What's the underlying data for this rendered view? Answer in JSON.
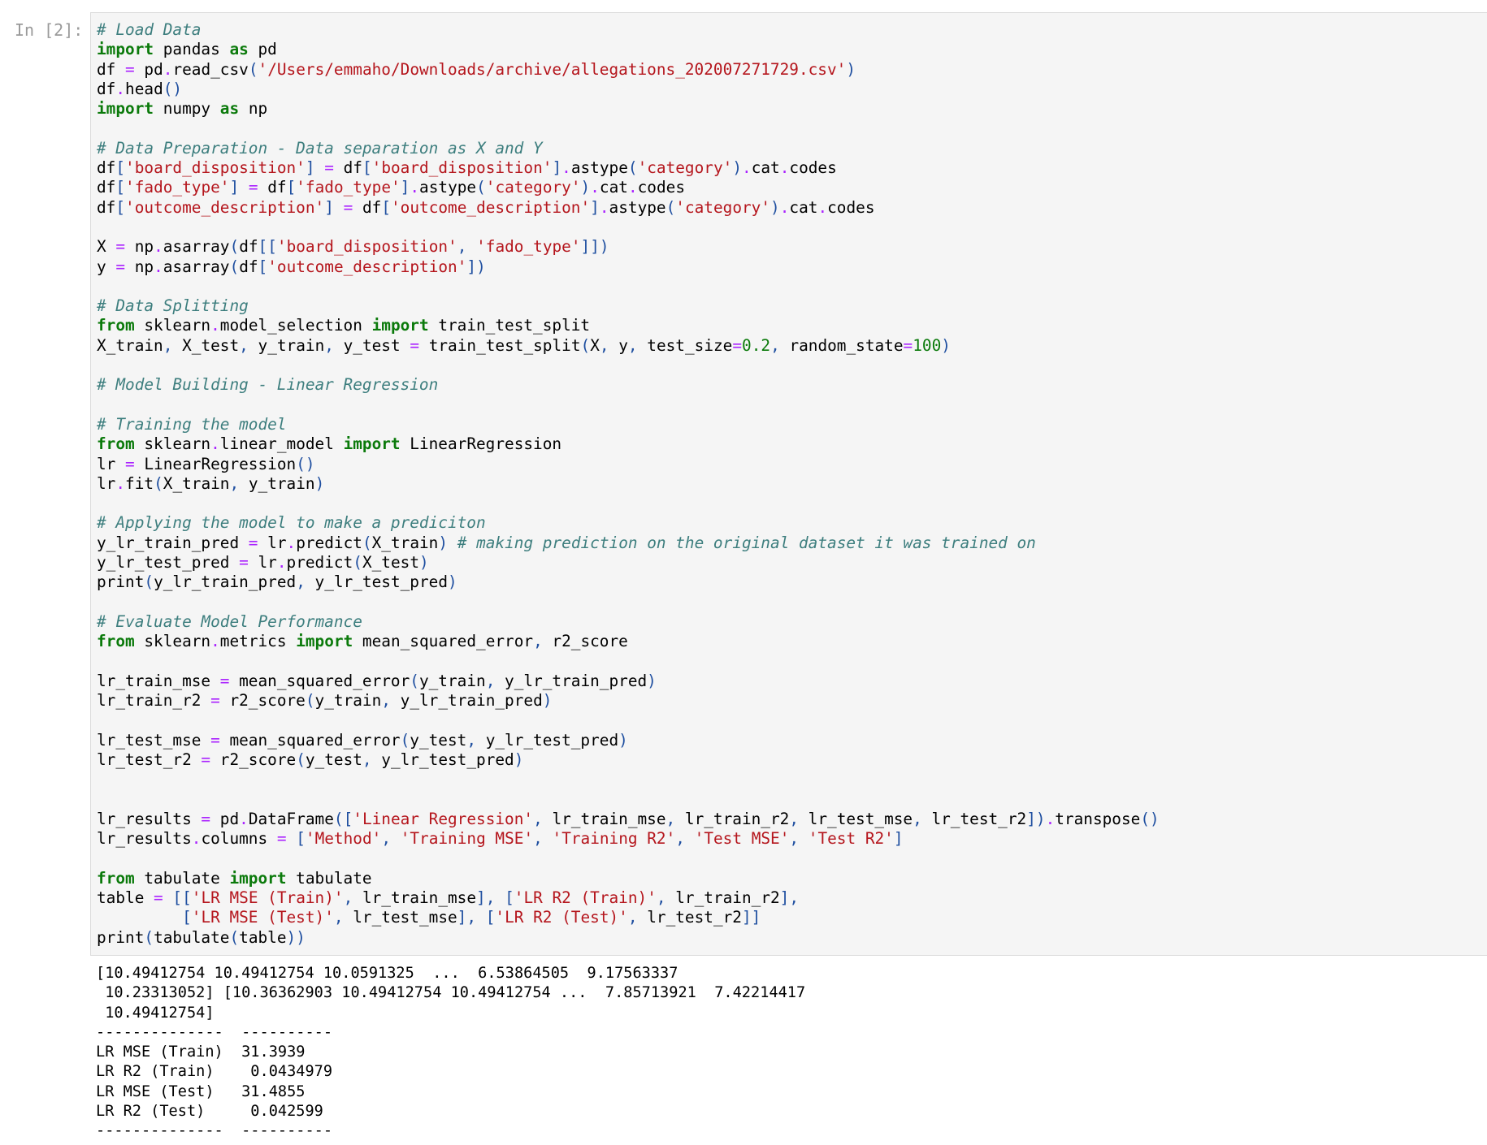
{
  "cell": {
    "prompt": "In [2]:",
    "code_lines": [
      [
        [
          "cm",
          "# Load Data"
        ]
      ],
      [
        [
          "kw",
          "import"
        ],
        [
          "",
          " pandas "
        ],
        [
          "kw",
          "as"
        ],
        [
          "",
          " pd"
        ]
      ],
      [
        [
          "",
          "df "
        ],
        [
          "op",
          "="
        ],
        [
          "",
          " pd"
        ],
        [
          "op",
          "."
        ],
        [
          "",
          "read_csv"
        ],
        [
          "pn",
          "("
        ],
        [
          "st",
          "'/Users/emmaho/Downloads/archive/allegations_202007271729.csv'"
        ],
        [
          "pn",
          ")"
        ]
      ],
      [
        [
          "",
          "df"
        ],
        [
          "op",
          "."
        ],
        [
          "",
          "head"
        ],
        [
          "pn",
          "()"
        ]
      ],
      [
        [
          "kw",
          "import"
        ],
        [
          "",
          " numpy "
        ],
        [
          "kw",
          "as"
        ],
        [
          "",
          " np"
        ]
      ],
      [],
      [
        [
          "cm",
          "# Data Preparation - Data separation as X and Y"
        ]
      ],
      [
        [
          "",
          "df"
        ],
        [
          "pn",
          "["
        ],
        [
          "st",
          "'board_disposition'"
        ],
        [
          "pn",
          "]"
        ],
        [
          "",
          " "
        ],
        [
          "op",
          "="
        ],
        [
          "",
          " df"
        ],
        [
          "pn",
          "["
        ],
        [
          "st",
          "'board_disposition'"
        ],
        [
          "pn",
          "]"
        ],
        [
          "op",
          "."
        ],
        [
          "",
          "astype"
        ],
        [
          "pn",
          "("
        ],
        [
          "st",
          "'category'"
        ],
        [
          "pn",
          ")"
        ],
        [
          "op",
          "."
        ],
        [
          "",
          "cat"
        ],
        [
          "op",
          "."
        ],
        [
          "",
          "codes"
        ]
      ],
      [
        [
          "",
          "df"
        ],
        [
          "pn",
          "["
        ],
        [
          "st",
          "'fado_type'"
        ],
        [
          "pn",
          "]"
        ],
        [
          "",
          " "
        ],
        [
          "op",
          "="
        ],
        [
          "",
          " df"
        ],
        [
          "pn",
          "["
        ],
        [
          "st",
          "'fado_type'"
        ],
        [
          "pn",
          "]"
        ],
        [
          "op",
          "."
        ],
        [
          "",
          "astype"
        ],
        [
          "pn",
          "("
        ],
        [
          "st",
          "'category'"
        ],
        [
          "pn",
          ")"
        ],
        [
          "op",
          "."
        ],
        [
          "",
          "cat"
        ],
        [
          "op",
          "."
        ],
        [
          "",
          "codes"
        ]
      ],
      [
        [
          "",
          "df"
        ],
        [
          "pn",
          "["
        ],
        [
          "st",
          "'outcome_description'"
        ],
        [
          "pn",
          "]"
        ],
        [
          "",
          " "
        ],
        [
          "op",
          "="
        ],
        [
          "",
          " df"
        ],
        [
          "pn",
          "["
        ],
        [
          "st",
          "'outcome_description'"
        ],
        [
          "pn",
          "]"
        ],
        [
          "op",
          "."
        ],
        [
          "",
          "astype"
        ],
        [
          "pn",
          "("
        ],
        [
          "st",
          "'category'"
        ],
        [
          "pn",
          ")"
        ],
        [
          "op",
          "."
        ],
        [
          "",
          "cat"
        ],
        [
          "op",
          "."
        ],
        [
          "",
          "codes"
        ]
      ],
      [],
      [
        [
          "",
          "X "
        ],
        [
          "op",
          "="
        ],
        [
          "",
          " np"
        ],
        [
          "op",
          "."
        ],
        [
          "",
          "asarray"
        ],
        [
          "pn",
          "("
        ],
        [
          "",
          "df"
        ],
        [
          "pn",
          "[["
        ],
        [
          "st",
          "'board_disposition'"
        ],
        [
          "pn",
          ","
        ],
        [
          "",
          " "
        ],
        [
          "st",
          "'fado_type'"
        ],
        [
          "pn",
          "]])"
        ]
      ],
      [
        [
          "",
          "y "
        ],
        [
          "op",
          "="
        ],
        [
          "",
          " np"
        ],
        [
          "op",
          "."
        ],
        [
          "",
          "asarray"
        ],
        [
          "pn",
          "("
        ],
        [
          "",
          "df"
        ],
        [
          "pn",
          "["
        ],
        [
          "st",
          "'outcome_description'"
        ],
        [
          "pn",
          "])"
        ]
      ],
      [],
      [
        [
          "cm",
          "# Data Splitting"
        ]
      ],
      [
        [
          "kw",
          "from"
        ],
        [
          "",
          " sklearn"
        ],
        [
          "op",
          "."
        ],
        [
          "",
          "model_selection "
        ],
        [
          "kw",
          "import"
        ],
        [
          "",
          " train_test_split"
        ]
      ],
      [
        [
          "",
          "X_train"
        ],
        [
          "pn",
          ","
        ],
        [
          "",
          " X_test"
        ],
        [
          "pn",
          ","
        ],
        [
          "",
          " y_train"
        ],
        [
          "pn",
          ","
        ],
        [
          "",
          " y_test "
        ],
        [
          "op",
          "="
        ],
        [
          "",
          " train_test_split"
        ],
        [
          "pn",
          "("
        ],
        [
          "",
          "X"
        ],
        [
          "pn",
          ","
        ],
        [
          "",
          " y"
        ],
        [
          "pn",
          ","
        ],
        [
          "",
          " test_size"
        ],
        [
          "op",
          "="
        ],
        [
          "nm",
          "0.2"
        ],
        [
          "pn",
          ","
        ],
        [
          "",
          " random_state"
        ],
        [
          "op",
          "="
        ],
        [
          "nm",
          "100"
        ],
        [
          "pn",
          ")"
        ]
      ],
      [],
      [
        [
          "cm",
          "# Model Building - Linear Regression"
        ]
      ],
      [],
      [
        [
          "cm",
          "# Training the model"
        ]
      ],
      [
        [
          "kw",
          "from"
        ],
        [
          "",
          " sklearn"
        ],
        [
          "op",
          "."
        ],
        [
          "",
          "linear_model "
        ],
        [
          "kw",
          "import"
        ],
        [
          "",
          " LinearRegression"
        ]
      ],
      [
        [
          "",
          "lr "
        ],
        [
          "op",
          "="
        ],
        [
          "",
          " LinearRegression"
        ],
        [
          "pn",
          "()"
        ]
      ],
      [
        [
          "",
          "lr"
        ],
        [
          "op",
          "."
        ],
        [
          "",
          "fit"
        ],
        [
          "pn",
          "("
        ],
        [
          "",
          "X_train"
        ],
        [
          "pn",
          ","
        ],
        [
          "",
          " y_train"
        ],
        [
          "pn",
          ")"
        ]
      ],
      [],
      [
        [
          "cm",
          "# Applying the model to make a prediciton"
        ]
      ],
      [
        [
          "",
          "y_lr_train_pred "
        ],
        [
          "op",
          "="
        ],
        [
          "",
          " lr"
        ],
        [
          "op",
          "."
        ],
        [
          "",
          "predict"
        ],
        [
          "pn",
          "("
        ],
        [
          "",
          "X_train"
        ],
        [
          "pn",
          ")"
        ],
        [
          "",
          " "
        ],
        [
          "cm",
          "# making prediction on the original dataset it was trained on"
        ]
      ],
      [
        [
          "",
          "y_lr_test_pred "
        ],
        [
          "op",
          "="
        ],
        [
          "",
          " lr"
        ],
        [
          "op",
          "."
        ],
        [
          "",
          "predict"
        ],
        [
          "pn",
          "("
        ],
        [
          "",
          "X_test"
        ],
        [
          "pn",
          ")"
        ]
      ],
      [
        [
          "",
          "print"
        ],
        [
          "pn",
          "("
        ],
        [
          "",
          "y_lr_train_pred"
        ],
        [
          "pn",
          ","
        ],
        [
          "",
          " y_lr_test_pred"
        ],
        [
          "pn",
          ")"
        ]
      ],
      [],
      [
        [
          "cm",
          "# Evaluate Model Performance"
        ]
      ],
      [
        [
          "kw",
          "from"
        ],
        [
          "",
          " sklearn"
        ],
        [
          "op",
          "."
        ],
        [
          "",
          "metrics "
        ],
        [
          "kw",
          "import"
        ],
        [
          "",
          " mean_squared_error"
        ],
        [
          "pn",
          ","
        ],
        [
          "",
          " r2_score"
        ]
      ],
      [],
      [
        [
          "",
          "lr_train_mse "
        ],
        [
          "op",
          "="
        ],
        [
          "",
          " mean_squared_error"
        ],
        [
          "pn",
          "("
        ],
        [
          "",
          "y_train"
        ],
        [
          "pn",
          ","
        ],
        [
          "",
          " y_lr_train_pred"
        ],
        [
          "pn",
          ")"
        ]
      ],
      [
        [
          "",
          "lr_train_r2 "
        ],
        [
          "op",
          "="
        ],
        [
          "",
          " r2_score"
        ],
        [
          "pn",
          "("
        ],
        [
          "",
          "y_train"
        ],
        [
          "pn",
          ","
        ],
        [
          "",
          " y_lr_train_pred"
        ],
        [
          "pn",
          ")"
        ]
      ],
      [],
      [
        [
          "",
          "lr_test_mse "
        ],
        [
          "op",
          "="
        ],
        [
          "",
          " mean_squared_error"
        ],
        [
          "pn",
          "("
        ],
        [
          "",
          "y_test"
        ],
        [
          "pn",
          ","
        ],
        [
          "",
          " y_lr_test_pred"
        ],
        [
          "pn",
          ")"
        ]
      ],
      [
        [
          "",
          "lr_test_r2 "
        ],
        [
          "op",
          "="
        ],
        [
          "",
          " r2_score"
        ],
        [
          "pn",
          "("
        ],
        [
          "",
          "y_test"
        ],
        [
          "pn",
          ","
        ],
        [
          "",
          " y_lr_test_pred"
        ],
        [
          "pn",
          ")"
        ]
      ],
      [],
      [],
      [
        [
          "",
          "lr_results "
        ],
        [
          "op",
          "="
        ],
        [
          "",
          " pd"
        ],
        [
          "op",
          "."
        ],
        [
          "",
          "DataFrame"
        ],
        [
          "pn",
          "(["
        ],
        [
          "st",
          "'Linear Regression'"
        ],
        [
          "pn",
          ","
        ],
        [
          "",
          " lr_train_mse"
        ],
        [
          "pn",
          ","
        ],
        [
          "",
          " lr_train_r2"
        ],
        [
          "pn",
          ","
        ],
        [
          "",
          " lr_test_mse"
        ],
        [
          "pn",
          ","
        ],
        [
          "",
          " lr_test_r2"
        ],
        [
          "pn",
          "])"
        ],
        [
          "op",
          "."
        ],
        [
          "",
          "transpose"
        ],
        [
          "pn",
          "()"
        ]
      ],
      [
        [
          "",
          "lr_results"
        ],
        [
          "op",
          "."
        ],
        [
          "",
          "columns "
        ],
        [
          "op",
          "="
        ],
        [
          "",
          " "
        ],
        [
          "pn",
          "["
        ],
        [
          "st",
          "'Method'"
        ],
        [
          "pn",
          ","
        ],
        [
          "",
          " "
        ],
        [
          "st",
          "'Training MSE'"
        ],
        [
          "pn",
          ","
        ],
        [
          "",
          " "
        ],
        [
          "st",
          "'Training R2'"
        ],
        [
          "pn",
          ","
        ],
        [
          "",
          " "
        ],
        [
          "st",
          "'Test MSE'"
        ],
        [
          "pn",
          ","
        ],
        [
          "",
          " "
        ],
        [
          "st",
          "'Test R2'"
        ],
        [
          "pn",
          "]"
        ]
      ],
      [],
      [
        [
          "kw",
          "from"
        ],
        [
          "",
          " tabulate "
        ],
        [
          "kw",
          "import"
        ],
        [
          "",
          " tabulate"
        ]
      ],
      [
        [
          "",
          "table "
        ],
        [
          "op",
          "="
        ],
        [
          "",
          " "
        ],
        [
          "pn",
          "[["
        ],
        [
          "st",
          "'LR MSE (Train)'"
        ],
        [
          "pn",
          ","
        ],
        [
          "",
          " lr_train_mse"
        ],
        [
          "pn",
          "],"
        ],
        [
          "",
          " "
        ],
        [
          "pn",
          "["
        ],
        [
          "st",
          "'LR R2 (Train)'"
        ],
        [
          "pn",
          ","
        ],
        [
          "",
          " lr_train_r2"
        ],
        [
          "pn",
          "],"
        ]
      ],
      [
        [
          "",
          "         "
        ],
        [
          "pn",
          "["
        ],
        [
          "st",
          "'LR MSE (Test)'"
        ],
        [
          "pn",
          ","
        ],
        [
          "",
          " lr_test_mse"
        ],
        [
          "pn",
          "],"
        ],
        [
          "",
          " "
        ],
        [
          "pn",
          "["
        ],
        [
          "st",
          "'LR R2 (Test)'"
        ],
        [
          "pn",
          ","
        ],
        [
          "",
          " lr_test_r2"
        ],
        [
          "pn",
          "]]"
        ]
      ],
      [
        [
          "",
          "print"
        ],
        [
          "pn",
          "("
        ],
        [
          "",
          "tabulate"
        ],
        [
          "pn",
          "("
        ],
        [
          "",
          "table"
        ],
        [
          "pn",
          "))"
        ]
      ]
    ],
    "output_lines": [
      "[10.49412754 10.49412754 10.0591325  ...  6.53864505  9.17563337",
      " 10.23313052] [10.36362903 10.49412754 10.49412754 ...  7.85713921  7.42214417",
      " 10.49412754]",
      "--------------  ----------",
      "LR MSE (Train)  31.3939",
      "LR R2 (Train)    0.0434979",
      "LR MSE (Test)   31.4855",
      "LR R2 (Test)     0.042599",
      "--------------  ----------"
    ]
  },
  "colors": {
    "keyword": "#0b7a0b",
    "comment": "#3d7e7e",
    "string": "#b5161d",
    "number": "#0b7a0b",
    "operator": "#aa22ff",
    "punctuation": "#1f4fa0",
    "cell_background": "#f5f5f5",
    "prompt": "#9a9a9a"
  }
}
